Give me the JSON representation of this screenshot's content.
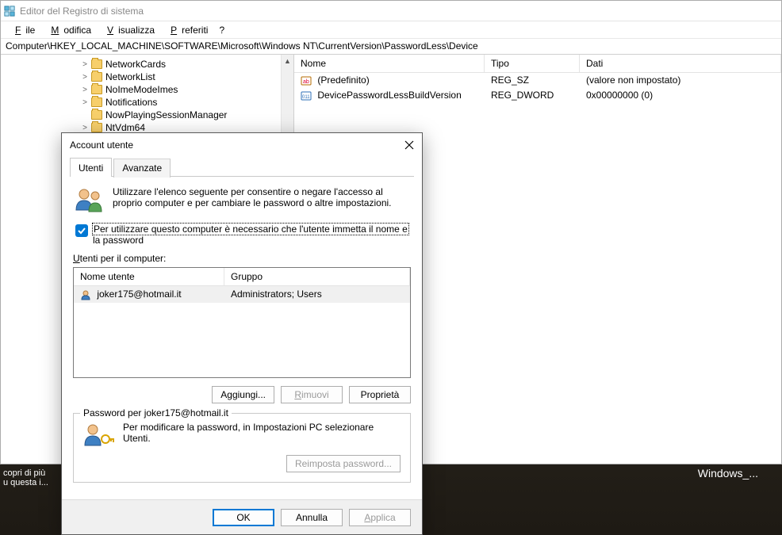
{
  "desktop": {
    "watermark": "Windows_...",
    "tip_line1": "copri di più",
    "tip_line2": "u questa i..."
  },
  "regedit": {
    "title": "Editor del Registro di sistema",
    "menu": {
      "file": "File",
      "file_m": "F",
      "edit": "Modifica",
      "edit_m": "M",
      "view": "Visualizza",
      "view_m": "V",
      "fav": "Preferiti",
      "fav_m": "P",
      "help": "?"
    },
    "path": "Computer\\HKEY_LOCAL_MACHINE\\SOFTWARE\\Microsoft\\Windows NT\\CurrentVersion\\PasswordLess\\Device",
    "tree": {
      "items": [
        {
          "label": "NetworkCards",
          "exp": ">"
        },
        {
          "label": "NetworkList",
          "exp": ">"
        },
        {
          "label": "NoImeModeImes",
          "exp": ">"
        },
        {
          "label": "Notifications",
          "exp": ">"
        },
        {
          "label": "NowPlayingSessionManager",
          "exp": ""
        },
        {
          "label": "NtVdm64",
          "exp": ">"
        }
      ]
    },
    "values": {
      "hdr_name": "Nome",
      "hdr_type": "Tipo",
      "hdr_data": "Dati",
      "rows": [
        {
          "name": "(Predefinito)",
          "type": "REG_SZ",
          "data": "(valore non impostato)",
          "kind": "sz"
        },
        {
          "name": "DevicePasswordLessBuildVersion",
          "type": "REG_DWORD",
          "data": "0x00000000 (0)",
          "kind": "dw"
        }
      ]
    }
  },
  "dialog": {
    "title": "Account utente",
    "close_tooltip": "Chiudi",
    "tabs": {
      "users": "Utenti",
      "advanced": "Avanzate"
    },
    "intro": "Utilizzare l'elenco seguente per consentire o negare l'accesso al proprio computer e per cambiare le password o altre impostazioni.",
    "chk_label_a": "Per utilizzare questo computer è necessario che l'utente immetta il nome e",
    "chk_label_b": "la password",
    "list_label": "Utenti per il computer:",
    "list_hdr_name": "Nome utente",
    "list_hdr_group": "Gruppo",
    "list_rows": [
      {
        "name": "joker175@hotmail.it",
        "group": "Administrators; Users"
      }
    ],
    "btn_add": "Aggiungi...",
    "btn_remove": "Rimuovi",
    "btn_remove_m": "R",
    "btn_props": "Proprietà",
    "group_title": "Password per joker175@hotmail.it",
    "group_text": "Per modificare la password, in Impostazioni PC selezionare Utenti.",
    "btn_reset": "Reimposta password...",
    "btn_ok": "OK",
    "btn_cancel": "Annulla",
    "btn_apply": "Applica"
  }
}
